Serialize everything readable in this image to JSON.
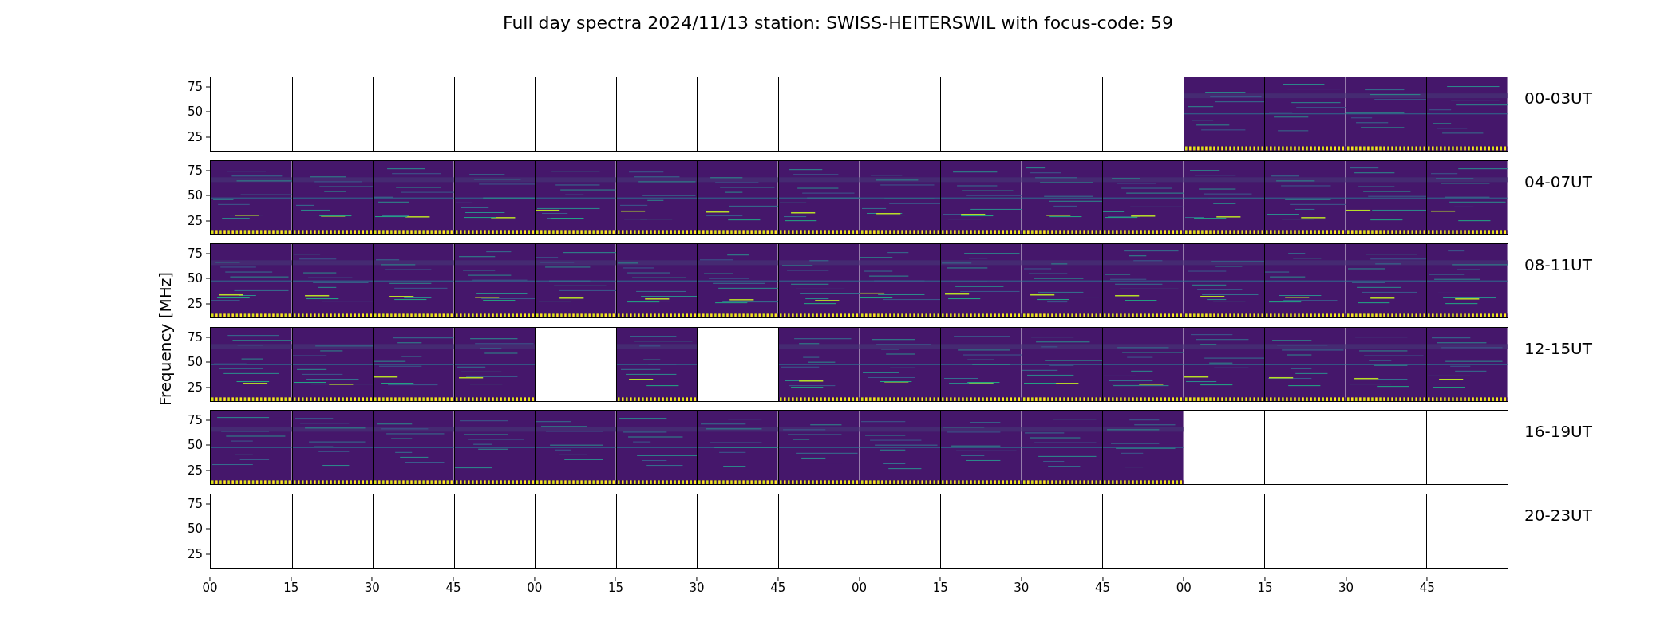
{
  "title": "Full day spectra 2024/11/13 station: SWISS-HEITERSWIL with focus-code: 59",
  "ylabel": "Frequency [MHz]",
  "rows": [
    {
      "label": "00-03UT",
      "yticks": [
        "75",
        "50",
        "25"
      ],
      "panels": [
        {
          "kind": "empty"
        },
        {
          "kind": "empty"
        },
        {
          "kind": "empty"
        },
        {
          "kind": "empty"
        },
        {
          "kind": "empty"
        },
        {
          "kind": "empty"
        },
        {
          "kind": "empty"
        },
        {
          "kind": "empty"
        },
        {
          "kind": "empty"
        },
        {
          "kind": "empty"
        },
        {
          "kind": "empty"
        },
        {
          "kind": "empty"
        },
        {
          "kind": "spectrum"
        },
        {
          "kind": "spectrum"
        },
        {
          "kind": "spectrum"
        },
        {
          "kind": "spectrum"
        }
      ]
    },
    {
      "label": "04-07UT",
      "yticks": [
        "75",
        "50",
        "25"
      ],
      "panels": [
        {
          "kind": "spectrum"
        },
        {
          "kind": "spectrum"
        },
        {
          "kind": "spectrum"
        },
        {
          "kind": "spectrum"
        },
        {
          "kind": "spectrum"
        },
        {
          "kind": "spectrum"
        },
        {
          "kind": "spectrum"
        },
        {
          "kind": "spectrum"
        },
        {
          "kind": "spectrum"
        },
        {
          "kind": "spectrum"
        },
        {
          "kind": "spectrum"
        },
        {
          "kind": "spectrum"
        },
        {
          "kind": "spectrum"
        },
        {
          "kind": "spectrum"
        },
        {
          "kind": "spectrum"
        },
        {
          "kind": "spectrum"
        }
      ]
    },
    {
      "label": "08-11UT",
      "yticks": [
        "75",
        "50",
        "25"
      ],
      "panels": [
        {
          "kind": "spectrum"
        },
        {
          "kind": "spectrum"
        },
        {
          "kind": "spectrum"
        },
        {
          "kind": "spectrum"
        },
        {
          "kind": "spectrum"
        },
        {
          "kind": "spectrum"
        },
        {
          "kind": "spectrum"
        },
        {
          "kind": "spectrum"
        },
        {
          "kind": "spectrum"
        },
        {
          "kind": "spectrum"
        },
        {
          "kind": "spectrum"
        },
        {
          "kind": "spectrum"
        },
        {
          "kind": "spectrum"
        },
        {
          "kind": "spectrum"
        },
        {
          "kind": "spectrum"
        },
        {
          "kind": "spectrum"
        }
      ]
    },
    {
      "label": "12-15UT",
      "yticks": [
        "75",
        "50",
        "25"
      ],
      "panels": [
        {
          "kind": "spectrum"
        },
        {
          "kind": "spectrum"
        },
        {
          "kind": "spectrum"
        },
        {
          "kind": "spectrum"
        },
        {
          "kind": "empty"
        },
        {
          "kind": "spectrum"
        },
        {
          "kind": "empty"
        },
        {
          "kind": "spectrum"
        },
        {
          "kind": "spectrum"
        },
        {
          "kind": "spectrum"
        },
        {
          "kind": "spectrum"
        },
        {
          "kind": "spectrum"
        },
        {
          "kind": "spectrum"
        },
        {
          "kind": "spectrum"
        },
        {
          "kind": "spectrum"
        },
        {
          "kind": "spectrum"
        }
      ]
    },
    {
      "label": "16-19UT",
      "yticks": [
        "75",
        "50",
        "25"
      ],
      "panels": [
        {
          "kind": "spectrum"
        },
        {
          "kind": "spectrum"
        },
        {
          "kind": "spectrum"
        },
        {
          "kind": "spectrum"
        },
        {
          "kind": "spectrum"
        },
        {
          "kind": "spectrum"
        },
        {
          "kind": "spectrum"
        },
        {
          "kind": "spectrum"
        },
        {
          "kind": "spectrum"
        },
        {
          "kind": "spectrum"
        },
        {
          "kind": "spectrum"
        },
        {
          "kind": "spectrum"
        },
        {
          "kind": "empty"
        },
        {
          "kind": "empty"
        },
        {
          "kind": "empty"
        },
        {
          "kind": "empty"
        }
      ]
    },
    {
      "label": "20-23UT",
      "yticks": [
        "75",
        "50",
        "25"
      ],
      "panels": [
        {
          "kind": "empty"
        },
        {
          "kind": "empty"
        },
        {
          "kind": "empty"
        },
        {
          "kind": "empty"
        },
        {
          "kind": "empty"
        },
        {
          "kind": "empty"
        },
        {
          "kind": "empty"
        },
        {
          "kind": "empty"
        },
        {
          "kind": "empty"
        },
        {
          "kind": "empty"
        },
        {
          "kind": "empty"
        },
        {
          "kind": "empty"
        },
        {
          "kind": "empty"
        },
        {
          "kind": "empty"
        },
        {
          "kind": "empty"
        },
        {
          "kind": "empty"
        }
      ]
    }
  ],
  "xticks": [
    "00",
    "15",
    "30",
    "45",
    "00",
    "15",
    "30",
    "45",
    "00",
    "15",
    "30",
    "45",
    "00",
    "15",
    "30",
    "45"
  ]
}
